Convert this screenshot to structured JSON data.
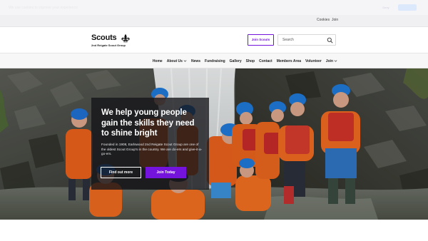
{
  "notice": {
    "text": "We use cookies to improve your experience",
    "dismiss_label": "Deny",
    "accept_label": ""
  },
  "util_bar": {
    "cookies": "Cookies",
    "join": "Join"
  },
  "header": {
    "logo_word": "Scouts",
    "logo_sub": "2nd Reigate Scout Group",
    "join_button": "Join Scouts",
    "search_placeholder": "Search"
  },
  "nav": {
    "items": [
      {
        "label": "Home",
        "dropdown": false
      },
      {
        "label": "About Us",
        "dropdown": true
      },
      {
        "label": "News",
        "dropdown": false
      },
      {
        "label": "Fundraising",
        "dropdown": false
      },
      {
        "label": "Gallery",
        "dropdown": false
      },
      {
        "label": "Shop",
        "dropdown": false
      },
      {
        "label": "Contact",
        "dropdown": false
      },
      {
        "label": "Members Area",
        "dropdown": false
      },
      {
        "label": "Volunteer",
        "dropdown": false
      },
      {
        "label": "Join",
        "dropdown": true
      }
    ]
  },
  "hero": {
    "title": "We help young people gain the skills they need to shine bright",
    "body": "Founded in 1908, Earlswood 2nd Reigate Scout Group are one of the oldest Scout Group's in the country. We are do-ers and give-it-a-go-ers.",
    "button_primary": "Find out more",
    "button_secondary": "Join Today"
  },
  "colors": {
    "brand_purple": "#7413dc",
    "hero_overlay": "#141418"
  }
}
